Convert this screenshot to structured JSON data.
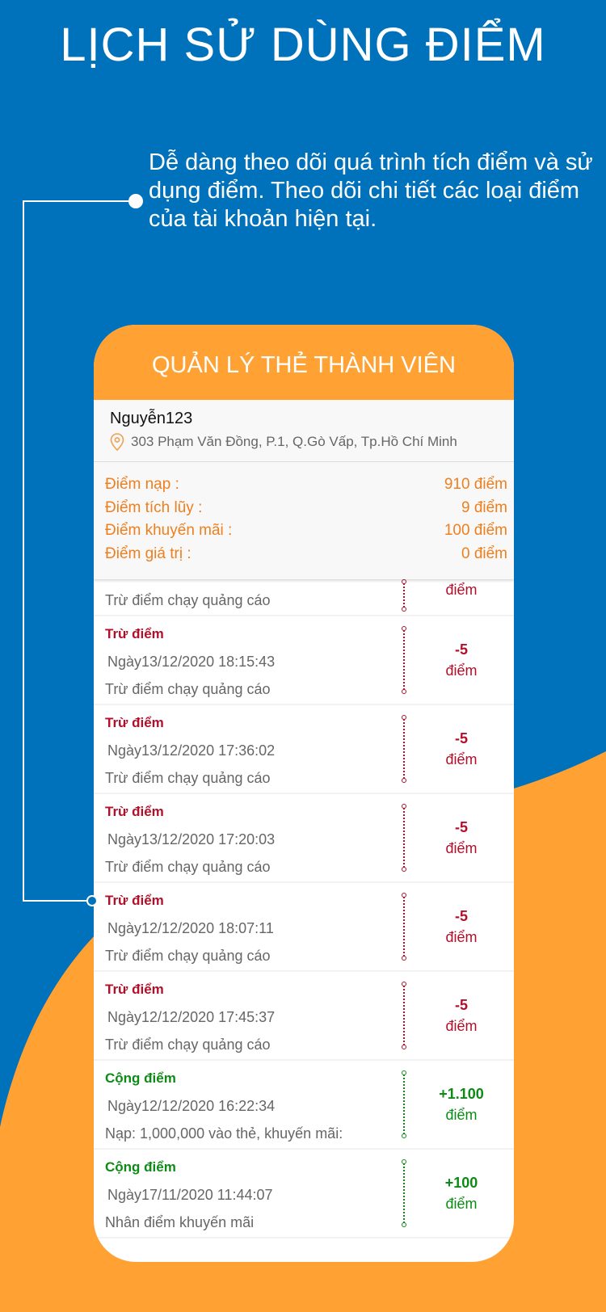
{
  "title": "LỊCH SỬ DÙNG ĐIỂM",
  "subtitle": "Dễ dàng theo dõi quá trình tích điểm và sử dụng điểm. Theo dõi chi tiết các loại điểm của tài khoản hiện tại.",
  "colors": {
    "blue": "#0071bb",
    "orange": "#ffa133",
    "minus": "#b0102a",
    "plus": "#0e8a17"
  },
  "card": {
    "header": "QUẢN LÝ THẺ THÀNH VIÊN",
    "user": {
      "name": "Nguyễn123",
      "address": "303 Phạm Văn Đồng, P.1, Q.Gò Vấp, Tp.Hồ Chí Minh"
    },
    "stats": [
      {
        "label": "Điểm nạp :",
        "value": "910 điểm"
      },
      {
        "label": "Điểm tích lũy :",
        "value": "9 điểm"
      },
      {
        "label": "Điểm khuyến mãi :",
        "value": "100 điểm"
      },
      {
        "label": "Điểm giá trị :",
        "value": "0 điểm"
      }
    ],
    "partial": {
      "note": "Trừ điểm chạy quảng cáo",
      "unit": "điểm"
    },
    "transactions": [
      {
        "type": "Trừ điểm",
        "date": "Ngày13/12/2020 18:15:43",
        "note": "Trừ điểm chạy quảng cáo",
        "amount": "-5",
        "unit": "điểm",
        "kind": "red"
      },
      {
        "type": "Trừ điểm",
        "date": "Ngày13/12/2020 17:36:02",
        "note": "Trừ điểm chạy quảng cáo",
        "amount": "-5",
        "unit": "điểm",
        "kind": "red"
      },
      {
        "type": "Trừ điểm",
        "date": "Ngày13/12/2020 17:20:03",
        "note": "Trừ điểm chạy quảng cáo",
        "amount": "-5",
        "unit": "điểm",
        "kind": "red"
      },
      {
        "type": "Trừ điểm",
        "date": "Ngày12/12/2020 18:07:11",
        "note": "Trừ điểm chạy quảng cáo",
        "amount": "-5",
        "unit": "điểm",
        "kind": "red"
      },
      {
        "type": "Trừ điểm",
        "date": "Ngày12/12/2020 17:45:37",
        "note": "Trừ điểm chạy quảng cáo",
        "amount": "-5",
        "unit": "điểm",
        "kind": "red"
      },
      {
        "type": "Cộng điểm",
        "date": "Ngày12/12/2020 16:22:34",
        "note": "Nạp: 1,000,000 vào thẻ, khuyến mãi:",
        "amount": "+1.100",
        "unit": "điểm",
        "kind": "green"
      },
      {
        "type": "Cộng điểm",
        "date": "Ngày17/11/2020 11:44:07",
        "note": "Nhân điểm khuyến mãi",
        "amount": "+100",
        "unit": "điểm",
        "kind": "green"
      }
    ]
  }
}
